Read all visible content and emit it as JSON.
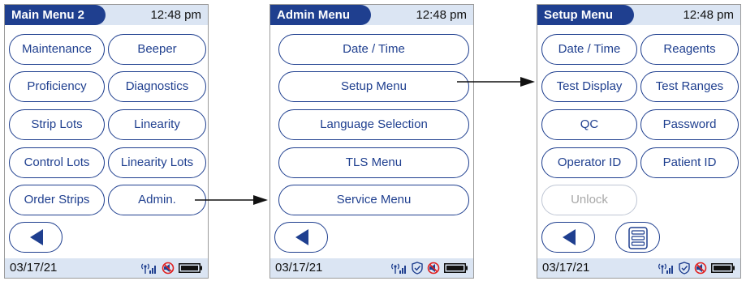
{
  "screens": [
    {
      "title": "Main Menu 2",
      "time": "12:48 pm",
      "buttons": [
        "Maintenance",
        "Beeper",
        "Proficiency",
        "Diagnostics",
        "Strip Lots",
        "Linearity",
        "Control Lots",
        "Linearity Lots",
        "Order Strips",
        "Admin."
      ],
      "date": "03/17/21"
    },
    {
      "title": "Admin Menu",
      "time": "12:48 pm",
      "buttons": [
        "Date / Time",
        "Setup Menu",
        "Language Selection",
        "TLS Menu",
        "Service Menu"
      ],
      "date": "03/17/21"
    },
    {
      "title": "Setup Menu",
      "time": "12:48 pm",
      "buttons": [
        "Date / Time",
        "Reagents",
        "Test Display",
        "Test Ranges",
        "QC",
        "Password",
        "Operator ID",
        "Patient ID",
        "Unlock"
      ],
      "date": "03/17/21"
    }
  ],
  "icons": {
    "back": "left-triangle-icon",
    "list": "list-icon",
    "wireless": "wireless-signal-icon",
    "shield": "shield-icon",
    "no_beep": "no-sound-icon",
    "battery": "battery-icon"
  },
  "colors": {
    "accent": "#1f3f8f",
    "header_bg": "#dbe5f3",
    "disabled": "#a8a8a8"
  }
}
